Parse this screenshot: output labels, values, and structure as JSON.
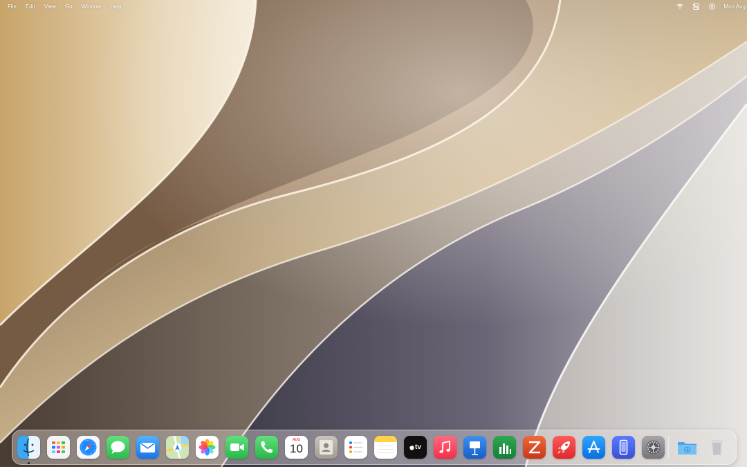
{
  "menubar": {
    "menus": [
      "File",
      "Edit",
      "View",
      "Go",
      "Window",
      "Help"
    ],
    "clock": "Mon Aug",
    "status_icons": [
      "wifi-icon",
      "control-center-icon",
      "siri-icon"
    ]
  },
  "calendar": {
    "month": "AUG",
    "day": "10"
  },
  "appletv": {
    "label": "tv"
  },
  "dock": {
    "apps": [
      {
        "name": "Finder",
        "icon": "finder-icon"
      },
      {
        "name": "Launchpad",
        "icon": "launchpad-icon"
      },
      {
        "name": "Safari",
        "icon": "safari-icon"
      },
      {
        "name": "Messages",
        "icon": "messages-icon"
      },
      {
        "name": "Mail",
        "icon": "mail-icon"
      },
      {
        "name": "Maps",
        "icon": "maps-icon"
      },
      {
        "name": "Photos",
        "icon": "photos-icon"
      },
      {
        "name": "FaceTime",
        "icon": "facetime-icon"
      },
      {
        "name": "Phone",
        "icon": "phone-icon"
      },
      {
        "name": "Calendar",
        "icon": "calendar-icon"
      },
      {
        "name": "Contacts",
        "icon": "contacts-icon"
      },
      {
        "name": "Reminders",
        "icon": "reminders-icon"
      },
      {
        "name": "Notes",
        "icon": "notes-icon"
      },
      {
        "name": "TV",
        "icon": "appletv-icon"
      },
      {
        "name": "Music",
        "icon": "music-icon"
      },
      {
        "name": "Keynote",
        "icon": "keynote-icon"
      },
      {
        "name": "Numbers",
        "icon": "numbers-icon"
      },
      {
        "name": "Zed",
        "icon": "zed-icon"
      },
      {
        "name": "Rocket",
        "icon": "rocket-icon"
      },
      {
        "name": "App Store",
        "icon": "appstore-icon"
      },
      {
        "name": "iPhone Mirroring",
        "icon": "iphone-mirroring-icon"
      },
      {
        "name": "System Settings",
        "icon": "settings-icon"
      }
    ],
    "folders": [
      {
        "name": "Downloads",
        "icon": "downloads-folder-icon"
      },
      {
        "name": "Trash",
        "icon": "trash-icon"
      }
    ]
  },
  "colors": {
    "facetime": "#34c759",
    "messages": "#34c759",
    "safari": "#1a8cff",
    "music": "#fa2d48",
    "appstore": "#1a8cff"
  }
}
